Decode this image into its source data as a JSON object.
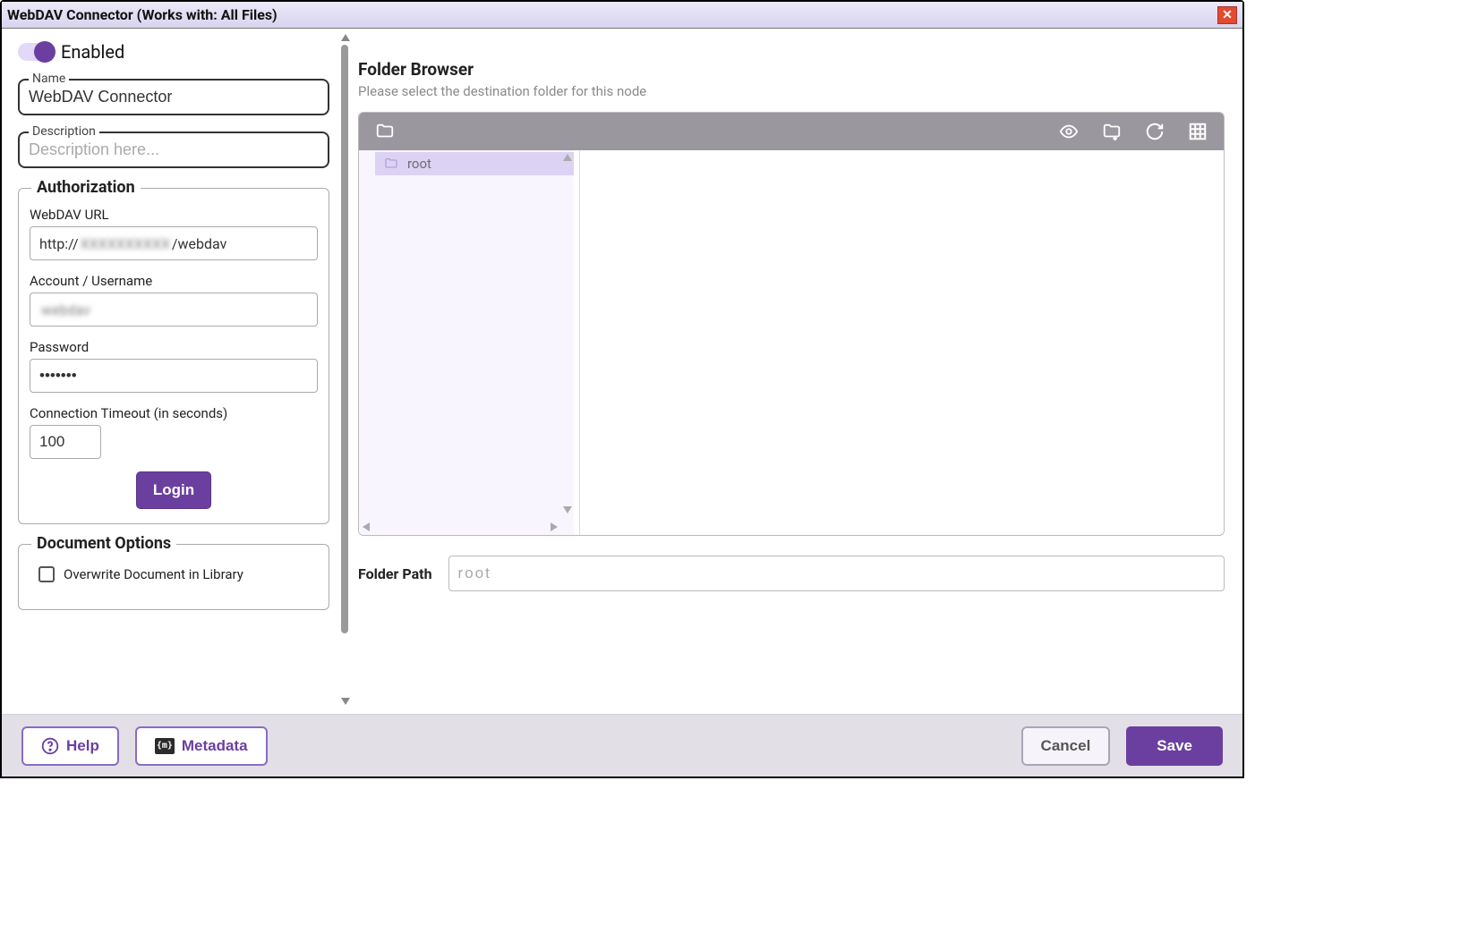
{
  "titlebar": {
    "title": "WebDAV Connector (Works with: All Files)"
  },
  "sidebar": {
    "enabled_label": "Enabled",
    "name": {
      "legend": "Name",
      "value": "WebDAV Connector"
    },
    "description": {
      "legend": "Description",
      "placeholder": "Description here..."
    },
    "authorization": {
      "legend": "Authorization",
      "url": {
        "label": "WebDAV URL",
        "prefix": "http://",
        "redacted": "XXXXXXXXXX",
        "suffix": "/webdav"
      },
      "username": {
        "label": "Account / Username",
        "value": "webdav"
      },
      "password": {
        "label": "Password",
        "value": "•••••••"
      },
      "timeout": {
        "label": "Connection Timeout (in seconds)",
        "value": "100"
      },
      "login_label": "Login"
    },
    "document_options": {
      "legend": "Document Options",
      "overwrite_label": "Overwrite Document in Library"
    }
  },
  "browser": {
    "title": "Folder Browser",
    "subtitle": "Please select the destination folder for this node",
    "tree": {
      "root_label": "root"
    },
    "folderpath": {
      "label": "Folder Path",
      "value": "root"
    }
  },
  "footer": {
    "help": "Help",
    "metadata": "Metadata",
    "cancel": "Cancel",
    "save": "Save"
  }
}
